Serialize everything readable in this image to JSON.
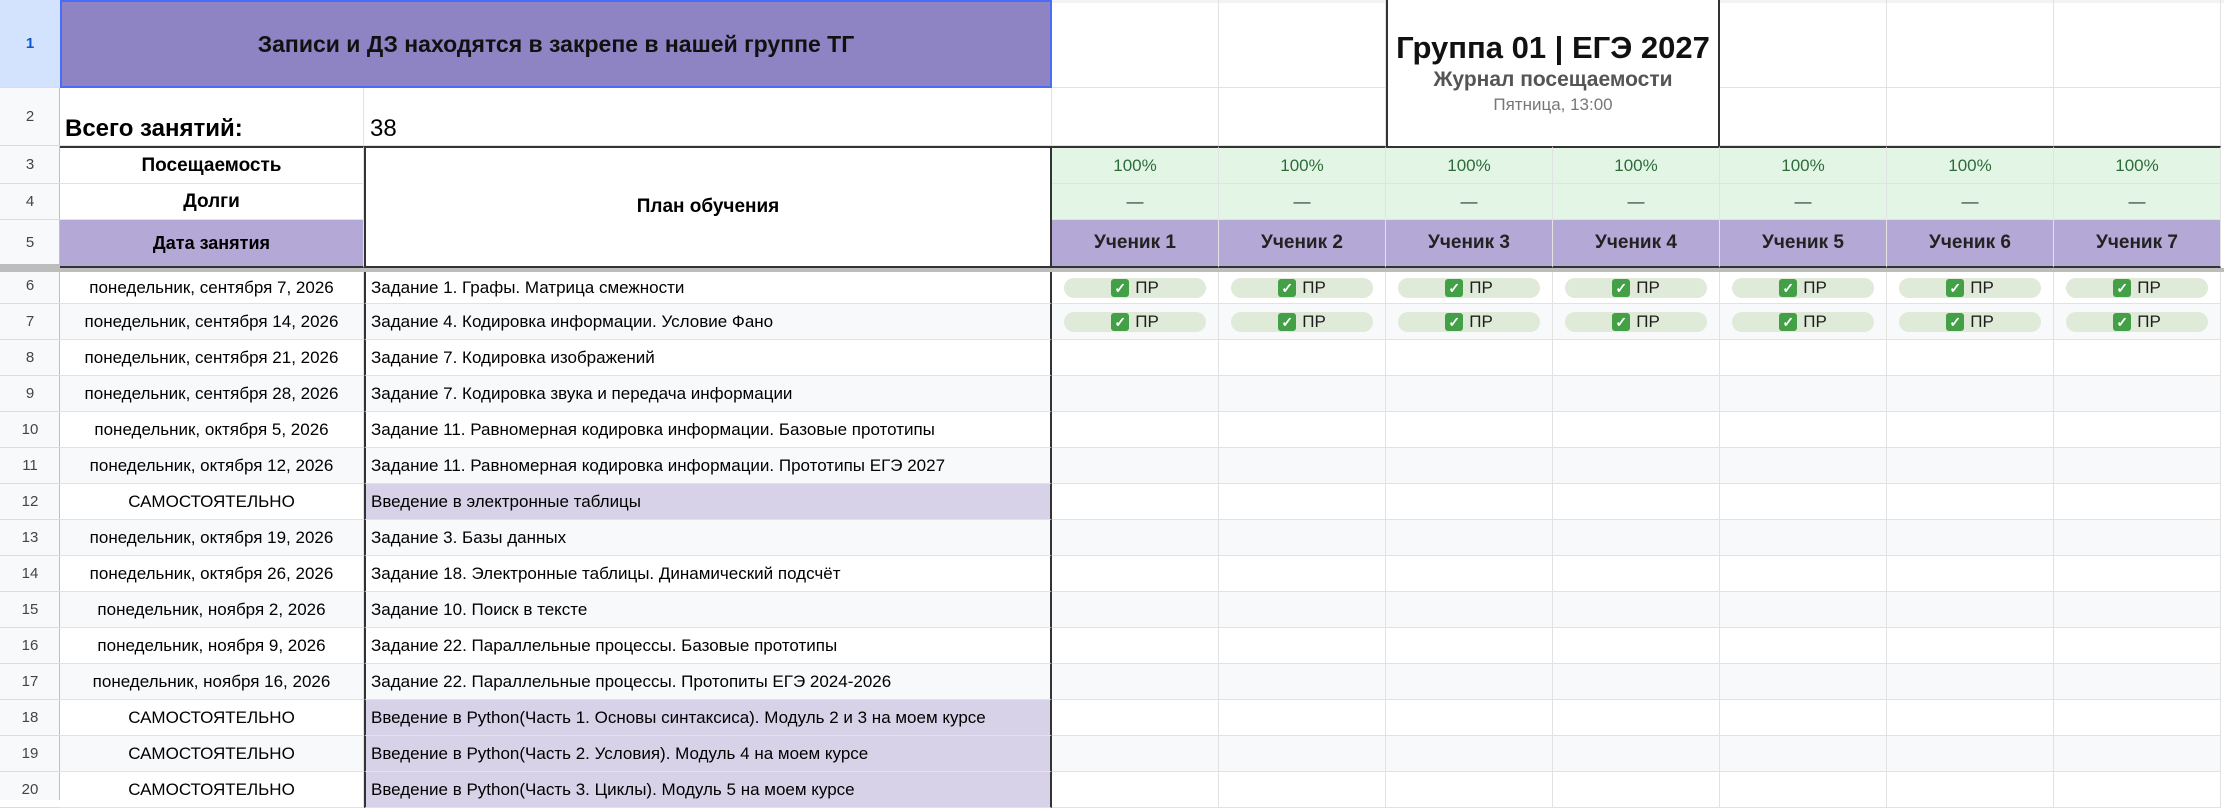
{
  "row_numbers": [
    "1",
    "2",
    "3",
    "4",
    "5",
    "6",
    "7",
    "8",
    "9",
    "10",
    "11",
    "12",
    "13",
    "14",
    "15",
    "16",
    "17",
    "18",
    "19",
    "20"
  ],
  "banner": "Записи и ДЗ находятся в закрепе в нашей группе ТГ",
  "total_label": "Всего занятий:",
  "total_value": "38",
  "group": {
    "title": "Группа 01 | ЕГЭ 2027",
    "subtitle": "Журнал посещаемости",
    "schedule": "Пятница, 13:00"
  },
  "labels": {
    "attendance": "Посещаемость",
    "debts": "Долги",
    "date": "Дата занятия",
    "plan": "План обучения"
  },
  "students": [
    {
      "name": "Ученик 1",
      "attendance": "100%",
      "debts": "—"
    },
    {
      "name": "Ученик 2",
      "attendance": "100%",
      "debts": "—"
    },
    {
      "name": "Ученик 3",
      "attendance": "100%",
      "debts": "—"
    },
    {
      "name": "Ученик 4",
      "attendance": "100%",
      "debts": "—"
    },
    {
      "name": "Ученик 5",
      "attendance": "100%",
      "debts": "—"
    },
    {
      "name": "Ученик 6",
      "attendance": "100%",
      "debts": "—"
    },
    {
      "name": "Ученик 7",
      "attendance": "100%",
      "debts": "—"
    }
  ],
  "chip_label": "ПР",
  "lessons": [
    {
      "date": "понедельник, сентября 7, 2026",
      "topic": "Задание 1. Графы. Матрица смежности",
      "self": false,
      "marks": true
    },
    {
      "date": "понедельник, сентября 14, 2026",
      "topic": "Задание 4. Кодировка информации. Условие Фано",
      "self": false,
      "marks": true
    },
    {
      "date": "понедельник, сентября 21, 2026",
      "topic": "Задание 7. Кодировка изображений",
      "self": false,
      "marks": false
    },
    {
      "date": "понедельник, сентября 28, 2026",
      "topic": "Задание 7. Кодировка звука и передача информации",
      "self": false,
      "marks": false
    },
    {
      "date": "понедельник, октября 5, 2026",
      "topic": "Задание 11. Равномерная кодировка информации. Базовые прототипы",
      "self": false,
      "marks": false
    },
    {
      "date": "понедельник, октября 12, 2026",
      "topic": "Задание 11. Равномерная кодировка информации. Прототипы ЕГЭ 2027",
      "self": false,
      "marks": false
    },
    {
      "date": "САМОСТОЯТЕЛЬНО",
      "topic": "Введение в электронные таблицы",
      "self": true,
      "marks": false
    },
    {
      "date": "понедельник, октября 19, 2026",
      "topic": "Задание 3. Базы данных",
      "self": false,
      "marks": false
    },
    {
      "date": "понедельник, октября 26, 2026",
      "topic": "Задание 18. Электронные таблицы. Динамический подсчёт",
      "self": false,
      "marks": false
    },
    {
      "date": "понедельник, ноября 2, 2026",
      "topic": "Задание 10. Поиск в тексте",
      "self": false,
      "marks": false
    },
    {
      "date": "понедельник, ноября 9, 2026",
      "topic": "Задание 22. Параллельные процессы. Базовые прототипы",
      "self": false,
      "marks": false
    },
    {
      "date": "понедельник, ноября 16, 2026",
      "topic": "Задание 22. Параллельные процессы. Протопиты ЕГЭ 2024-2026",
      "self": false,
      "marks": false
    },
    {
      "date": "САМОСТОЯТЕЛЬНО",
      "topic": "Введение в Python(Часть 1. Основы синтаксиса). Модуль 2 и 3 на моем курсе",
      "self": true,
      "marks": false
    },
    {
      "date": "САМОСТОЯТЕЛЬНО",
      "topic": "Введение в Python(Часть 2. Условия). Модуль 4 на моем курсе",
      "self": true,
      "marks": false
    },
    {
      "date": "САМОСТОЯТЕЛЬНО",
      "topic": "Введение в Python(Часть 3. Циклы). Модуль 5 на моем курсе",
      "self": true,
      "marks": false
    }
  ],
  "colors": {
    "purple_header": "#8e84c4",
    "lavender": "#d8d2e8",
    "student_header": "#b4a9d6",
    "green_light": "#e3f6e6",
    "chip_bg": "#dfead9",
    "check_green": "#43a047"
  }
}
